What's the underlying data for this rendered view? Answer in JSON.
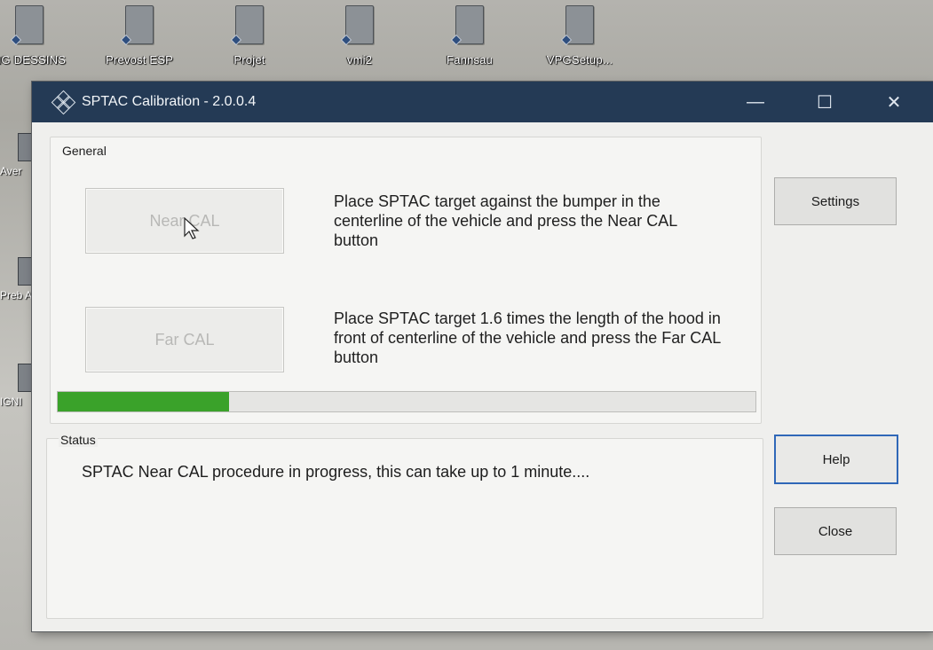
{
  "desktop": {
    "icons": [
      {
        "label": "NG DESSINS"
      },
      {
        "label": "Prevost ESP"
      },
      {
        "label": "Projet"
      },
      {
        "label": "vmi2"
      },
      {
        "label": "Fannsau"
      },
      {
        "label": "VPGSetup..."
      }
    ],
    "side_labels": [
      "Aver",
      "Preb Auto",
      "IGNI"
    ]
  },
  "window": {
    "title": "SPTAC Calibration - 2.0.0.4",
    "minimize_glyph": "—",
    "maximize_glyph": "☐",
    "close_glyph": "✕"
  },
  "general": {
    "label": "General",
    "near_button": "Near CAL",
    "near_instruction": "Place SPTAC target against the bumper in the centerline of the vehicle and press the Near CAL button",
    "far_button": "Far CAL",
    "far_instruction": "Place SPTAC target 1.6 times the length of the hood in front of centerline of the vehicle and press the Far CAL button",
    "progress_fraction": 0.245
  },
  "status": {
    "label": "Status",
    "message": "SPTAC Near CAL procedure in progress, this can take up to 1 minute...."
  },
  "buttons": {
    "settings": "Settings",
    "help": "Help",
    "close": "Close"
  },
  "colors": {
    "titlebar": "#243a55",
    "progress": "#3aa22a",
    "focus": "#2f67b8"
  }
}
